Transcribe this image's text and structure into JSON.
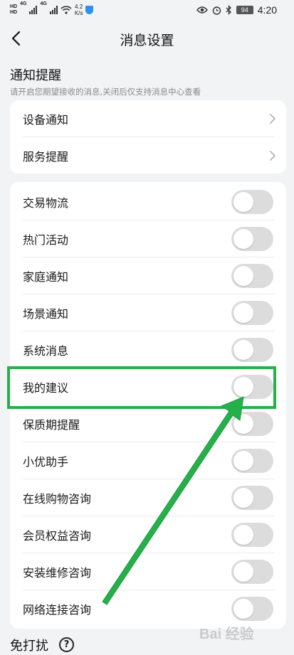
{
  "status_bar": {
    "hd_top": "HD",
    "hd_bottom": "HD",
    "net_1": "4G",
    "net_2": "4G",
    "speed_value": "4.2",
    "speed_unit": "K/s",
    "battery": "94",
    "time": "4:20"
  },
  "header": {
    "title": "消息设置"
  },
  "notify_section": {
    "title": "通知提醒",
    "hint": "请开启您期望接收的消息,关闭后仅支持消息中心查看",
    "nav_items": [
      {
        "label": "设备通知"
      },
      {
        "label": "服务提醒"
      }
    ]
  },
  "toggle_items": [
    {
      "label": "交易物流",
      "on": false
    },
    {
      "label": "热门活动",
      "on": false
    },
    {
      "label": "家庭通知",
      "on": false
    },
    {
      "label": "场景通知",
      "on": false
    },
    {
      "label": "系统消息",
      "on": false
    },
    {
      "label": "我的建议",
      "on": false
    },
    {
      "label": "保质期提醒",
      "on": false
    },
    {
      "label": "小优助手",
      "on": false
    },
    {
      "label": "在线购物咨询",
      "on": false
    },
    {
      "label": "会员权益咨询",
      "on": false
    },
    {
      "label": "安装维修咨询",
      "on": false
    },
    {
      "label": "网络连接咨询",
      "on": false
    }
  ],
  "dnd_section": {
    "title": "免打扰"
  },
  "watermark": "Bai 经验",
  "colors": {
    "annotation": "#25b04a",
    "toggle_off": "#dcdcdc",
    "background": "#f1f3f5"
  }
}
